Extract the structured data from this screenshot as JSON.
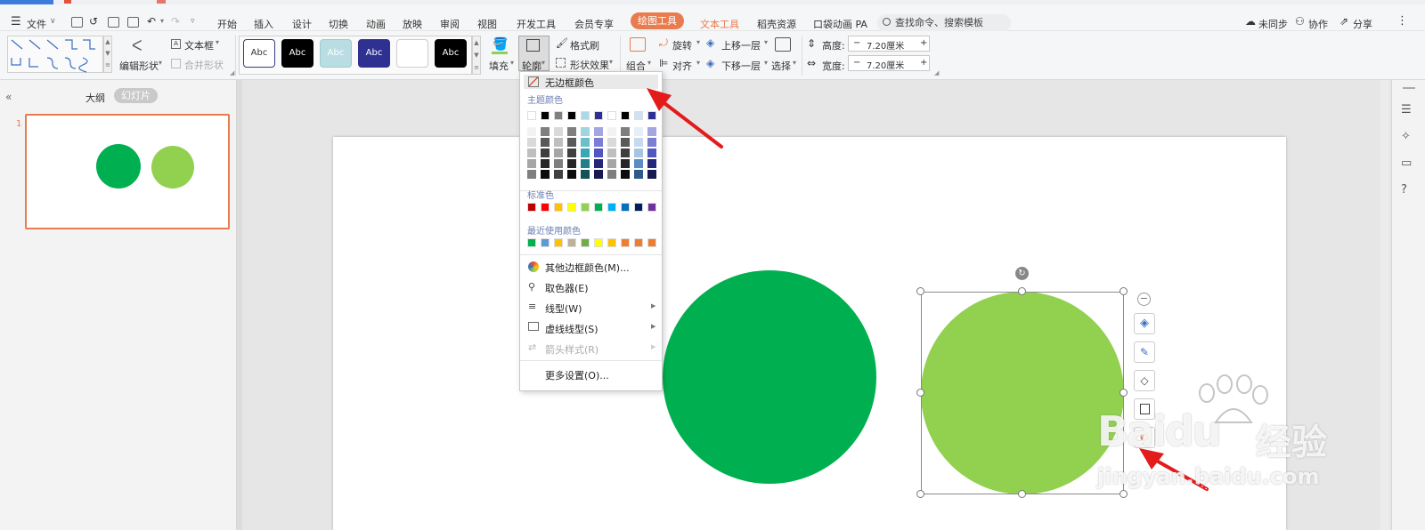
{
  "menubar": {
    "file": "文件",
    "tabs": [
      "开始",
      "插入",
      "设计",
      "切换",
      "动画",
      "放映",
      "审阅",
      "视图",
      "开发工具",
      "会员专享"
    ],
    "active_tab": "绘图工具",
    "text_tools": "文本工具",
    "shell_res": "稻壳资源",
    "pocket_anim": "口袋动画 PA",
    "search_placeholder": "查找命令、搜索模板",
    "sync": "未同步",
    "collab": "协作",
    "share": "分享"
  },
  "ribbon": {
    "edit_shape": "编辑形状",
    "textbox": "文本框",
    "merge_shape": "合并形状",
    "style_labels": [
      "Abc",
      "Abc",
      "Abc",
      "Abc",
      "",
      "Abc"
    ],
    "fill": "填充",
    "outline": "轮廓",
    "format_painter": "格式刷",
    "shape_effects": "形状效果",
    "group": "组合",
    "rotate": "旋转",
    "align": "对齐",
    "bring_forward": "上移一层",
    "send_backward": "下移一层",
    "select": "选择",
    "height_label": "高度:",
    "width_label": "宽度:",
    "height_value": "7.20厘米",
    "width_value": "7.20厘米"
  },
  "leftpanel": {
    "outline_tab": "大纲",
    "slides_tab": "幻灯片",
    "slide_number": "1"
  },
  "dropdown": {
    "no_border": "无边框颜色",
    "theme_colors": "主题颜色",
    "standard_colors": "标准色",
    "recent_colors": "最近使用颜色",
    "more_colors": "其他边框颜色(M)...",
    "eyedropper": "取色器(E)",
    "line_type": "线型(W)",
    "dash_type": "虚线线型(S)",
    "arrow_style": "箭头样式(R)",
    "more_settings": "更多设置(O)...",
    "theme_row1": [
      "#ffffff",
      "#000000",
      "#808080",
      "#000000",
      "#add8e6",
      "#2e3192",
      "#ffffff",
      "#000000",
      "#cfe2f3",
      "#2e3192"
    ],
    "standard_row": [
      "#c00000",
      "#ff0000",
      "#ffc000",
      "#ffff00",
      "#92d050",
      "#00b050",
      "#00b0f0",
      "#0070c0",
      "#002060",
      "#7030a0"
    ],
    "recent_row": [
      "#00b050",
      "#5b9bd5",
      "#ffc000",
      "#bfb09a",
      "#70ad47",
      "#ffff00",
      "#ffc000",
      "#ed7d31",
      "#ed7d31",
      "#ed7d31"
    ]
  },
  "shapes": {
    "circle_dark": "#00b050",
    "circle_light": "#92d050",
    "accent": "#e87c4e"
  },
  "watermark": {
    "brand": "Baidu",
    "cn": "经验",
    "url": "jingyan.baidu.com"
  }
}
